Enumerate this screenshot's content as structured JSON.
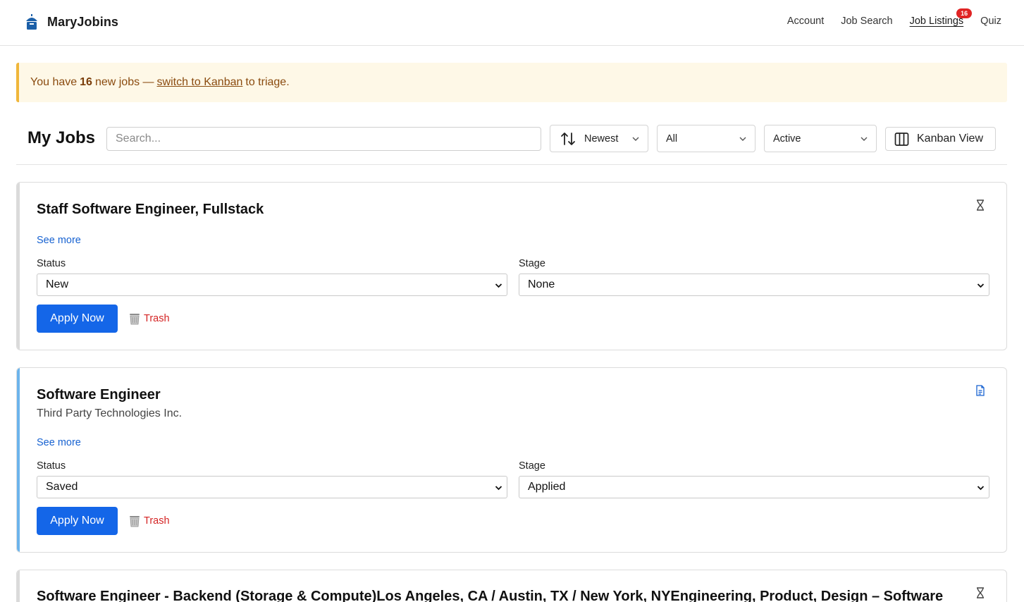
{
  "app": {
    "name": "MaryJobins",
    "nav": {
      "account": "Account",
      "job_search": "Job Search",
      "job_listings": "Job Listings",
      "job_listings_badge": "16",
      "quiz": "Quiz"
    }
  },
  "banner": {
    "prefix": "You have",
    "count": "16",
    "middle": "new jobs —",
    "link": "switch to Kanban",
    "suffix": "to triage."
  },
  "toolbar": {
    "title": "My Jobs",
    "search_placeholder": "Search...",
    "sort_value": "Newest",
    "filter_type_value": "All",
    "filter_state_value": "Active",
    "kanban_label": "Kanban View"
  },
  "jobs": [
    {
      "title": "Staff Software Engineer, Fullstack",
      "company": "",
      "see_more": "See more",
      "status_label": "Status",
      "status": "New",
      "stage_label": "Stage",
      "stage": "None",
      "apply_label": "Apply Now",
      "trash_label": "Trash",
      "icon": "hourglass-icon"
    },
    {
      "title": "Software Engineer",
      "company": "Third Party Technologies Inc.",
      "see_more": "See more",
      "status_label": "Status",
      "status": "Saved",
      "stage_label": "Stage",
      "stage": "Applied",
      "apply_label": "Apply Now",
      "trash_label": "Trash",
      "icon": "document-icon"
    },
    {
      "title": "Software Engineer - Backend (Storage & Compute)Los Angeles, CA / Austin, TX / New York, NYEngineering, Product, Design – Software",
      "icon": "hourglass-icon"
    }
  ],
  "colors": {
    "primary": "#1466e8",
    "link": "#1762d1",
    "danger": "#d42424",
    "badge": "#e02424",
    "banner_bg": "#fef8e7",
    "banner_border": "#f0b63a",
    "accent_blue": "#6cb4ec"
  }
}
